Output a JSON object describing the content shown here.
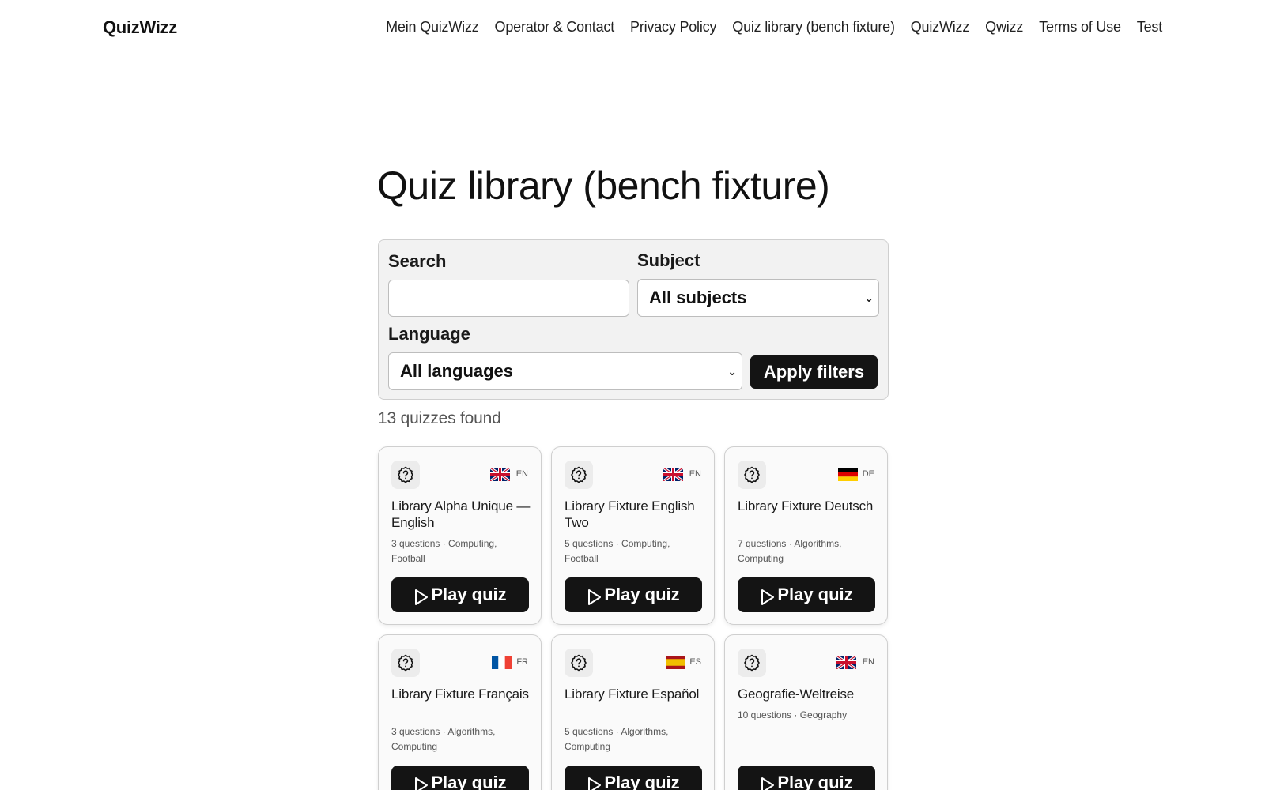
{
  "header": {
    "brand": "QuizWizz",
    "nav": [
      {
        "label": "Mein QuizWizz"
      },
      {
        "label": "Operator & Contact"
      },
      {
        "label": "Privacy Policy"
      },
      {
        "label": "Quiz library (bench fixture)"
      },
      {
        "label": "QuizWizz"
      },
      {
        "label": "Qwizz"
      },
      {
        "label": "Terms of Use"
      },
      {
        "label": "Test"
      }
    ]
  },
  "page": {
    "title": "Quiz library (bench fixture)"
  },
  "filters": {
    "search_label": "Search",
    "search_value": "",
    "subject_label": "Subject",
    "subject_selected": "All subjects",
    "language_label": "Language",
    "language_selected": "All languages",
    "apply_label": "Apply filters"
  },
  "results": {
    "count_text": "13 quizzes found"
  },
  "cards": [
    {
      "title": "Library Alpha Unique — English",
      "meta": "3 questions · Computing, Football",
      "lang": "EN",
      "flag": "uk-flag-icon",
      "play": "Play quiz"
    },
    {
      "title": "Library Fixture English Two",
      "meta": "5 questions · Computing, Football",
      "lang": "EN",
      "flag": "uk-flag-icon",
      "play": "Play quiz"
    },
    {
      "title": "Library Fixture Deutsch",
      "meta": "7 questions · Algorithms, Computing",
      "lang": "DE",
      "flag": "germany-flag-icon",
      "play": "Play quiz"
    },
    {
      "title": "Library Fixture Français",
      "meta": "3 questions · Algorithms, Computing",
      "lang": "FR",
      "flag": "france-flag-icon",
      "play": "Play quiz"
    },
    {
      "title": "Library Fixture Español",
      "meta": "5 questions · Algorithms, Computing",
      "lang": "ES",
      "flag": "spain-flag-icon",
      "play": "Play quiz"
    },
    {
      "title": "Geografie-Weltreise",
      "meta": "10 questions · Geography",
      "lang": "EN",
      "flag": "uk-flag-icon",
      "play": "Play quiz"
    }
  ],
  "colors": {
    "button": "#141414",
    "panel": "#f2f2f2",
    "card": "#fafafa",
    "border": "#cfcfcf"
  }
}
